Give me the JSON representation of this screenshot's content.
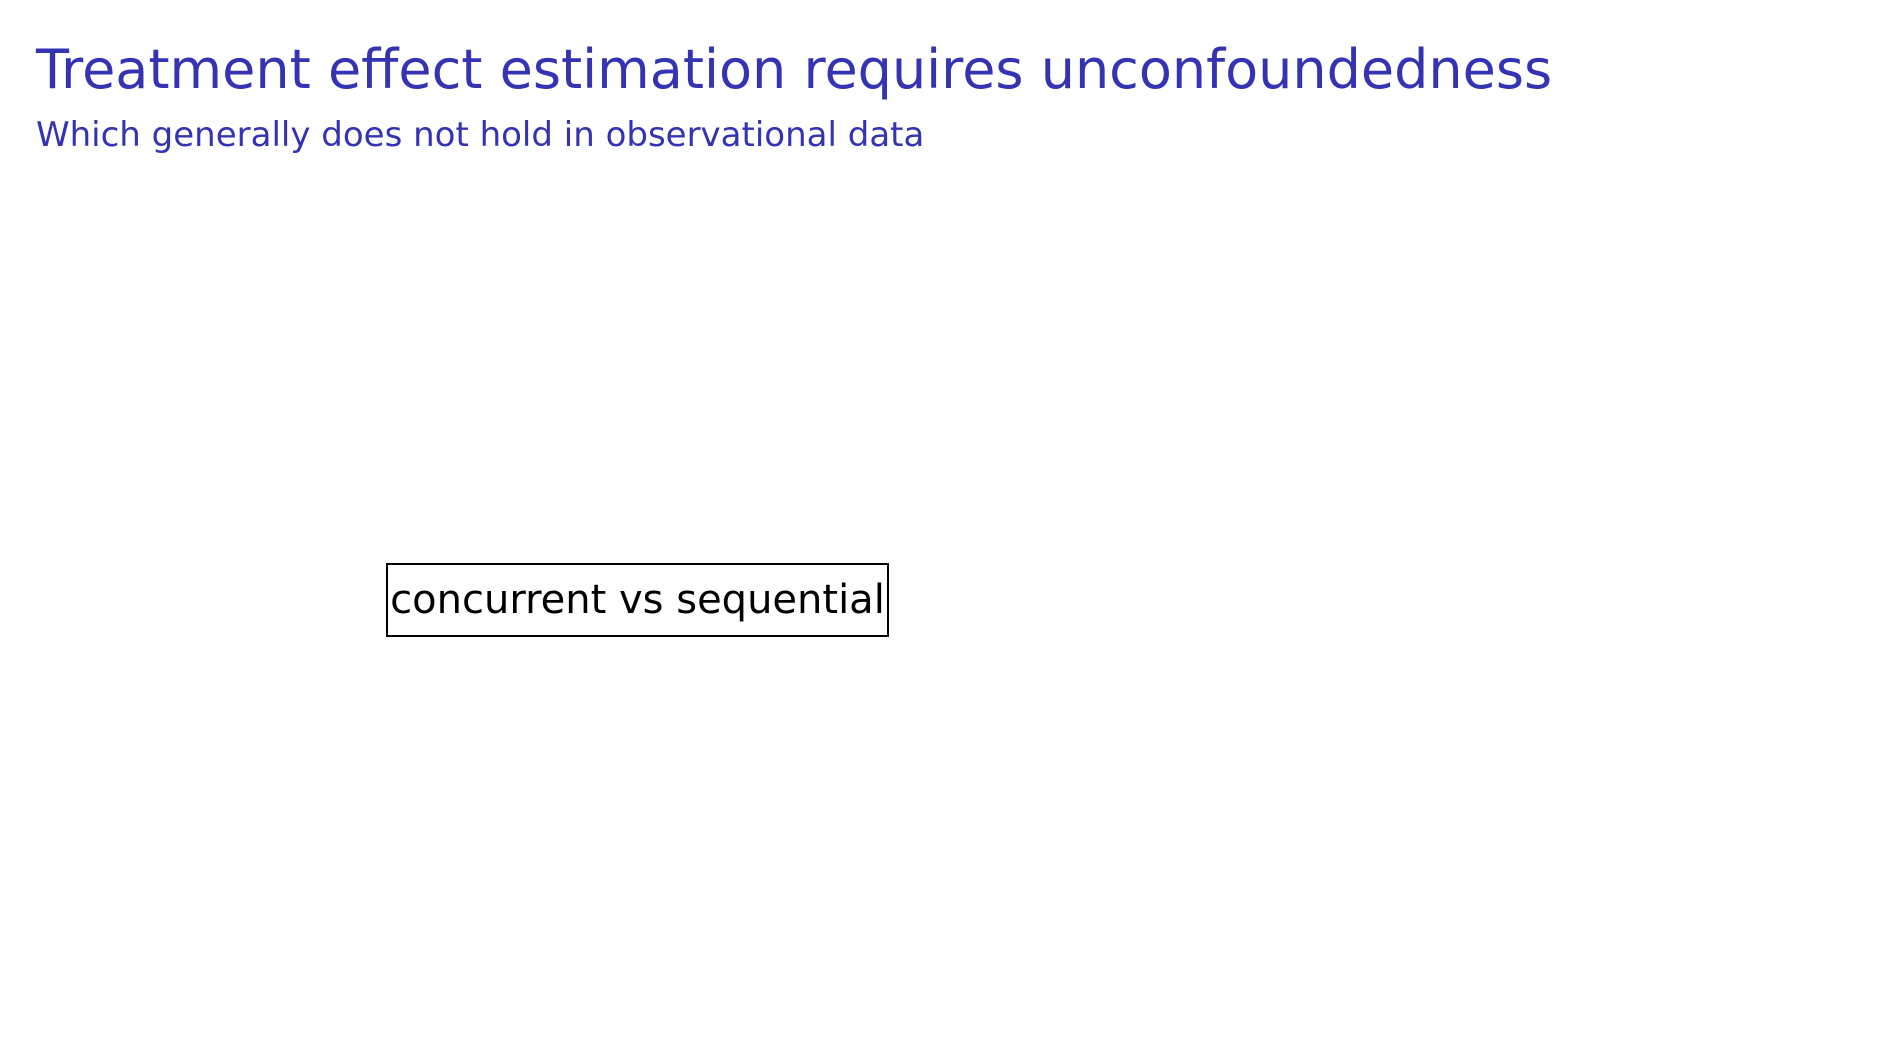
{
  "slide": {
    "title": "Treatment effect estimation requires unconfoundedness",
    "subtitle": "Which generally does not hold in observational data",
    "box_label": "concurrent vs sequential"
  },
  "colors": {
    "title": "#3333b3",
    "box_border": "#000000",
    "box_text": "#000000"
  }
}
